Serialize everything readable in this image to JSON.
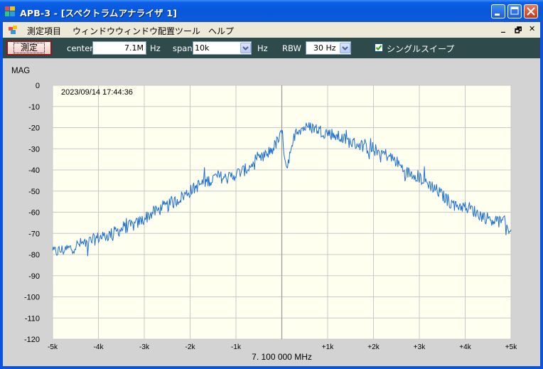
{
  "window": {
    "title": "APB-3 - [スペクトラムアナライザ 1]"
  },
  "menu": {
    "items": [
      "測定項目",
      "ウィンドウ",
      "ウィンドウ配置",
      "ツール",
      "ヘルプ"
    ],
    "mdi_min": "_",
    "mdi_restore": "🗗",
    "mdi_close": "✕"
  },
  "toolbar": {
    "measure_label": "測定",
    "center_label": "center",
    "center_value": "7.1M",
    "center_unit": "Hz",
    "span_label": "span",
    "span_value": "10k",
    "span_unit": "Hz",
    "rbw_label": "RBW",
    "rbw_value": "30 Hz",
    "single_sweep_label": "シングルスイープ",
    "single_sweep_checked": true
  },
  "colors": {
    "plot_bg": "#fffff0",
    "grid": "#c8c8c8",
    "trace": "#1f6fd0",
    "center_line": "#9a9a9a"
  },
  "chart_data": {
    "type": "line",
    "timestamp": "2023/09/14 17:44:36",
    "ylabel": "MAG",
    "xlabel": "7. 100 000 MHz",
    "ylim": [
      -120,
      0
    ],
    "yticks": [
      0,
      -10,
      -20,
      -30,
      -40,
      -50,
      -60,
      -70,
      -80,
      -90,
      -100,
      -110,
      -120
    ],
    "ytick_labels": [
      "0",
      "-10",
      "-20",
      "-30",
      "-40",
      "-50",
      "-60",
      "-70",
      "-80",
      "-90",
      "-100",
      "-110",
      "-120"
    ],
    "xlim": [
      -5,
      5
    ],
    "xticks": [
      -5,
      -4,
      -3,
      -2,
      -1,
      0,
      1,
      2,
      3,
      4,
      5
    ],
    "xtick_labels": [
      "-5k",
      "-4k",
      "-3k",
      "-2k",
      "-1k",
      "",
      "+1k",
      "+2k",
      "+3k",
      "+4k",
      "+5k"
    ],
    "grid": true,
    "series": [
      {
        "x": [
          -5.0,
          -4.8,
          -4.6,
          -4.4,
          -4.2,
          -4.0,
          -3.8,
          -3.6,
          -3.4,
          -3.2,
          -3.0,
          -2.8,
          -2.6,
          -2.4,
          -2.2,
          -2.0,
          -1.8,
          -1.6,
          -1.4,
          -1.2,
          -1.0,
          -0.8,
          -0.6,
          -0.4,
          -0.2,
          -0.05,
          0.0,
          0.1,
          0.2,
          0.3,
          0.5,
          0.7,
          0.9,
          1.1,
          1.3,
          1.5,
          1.7,
          1.9,
          2.1,
          2.3,
          2.5,
          2.7,
          2.9,
          3.1,
          3.3,
          3.5,
          3.7,
          3.9,
          4.1,
          4.3,
          4.5,
          4.7,
          4.9,
          5.0
        ],
        "y": [
          -79,
          -78,
          -77,
          -75,
          -74,
          -72,
          -71,
          -69,
          -67,
          -66,
          -63,
          -60,
          -58,
          -56,
          -53,
          -50,
          -47,
          -45,
          -43,
          -44,
          -42,
          -40,
          -37,
          -34,
          -30,
          -25,
          -23,
          -38,
          -33,
          -21,
          -20,
          -20,
          -22,
          -23,
          -25,
          -27,
          -28,
          -30,
          -31,
          -33,
          -36,
          -41,
          -42,
          -45,
          -48,
          -52,
          -56,
          -57,
          -58,
          -61,
          -63,
          -64,
          -66,
          -69
        ]
      }
    ]
  }
}
